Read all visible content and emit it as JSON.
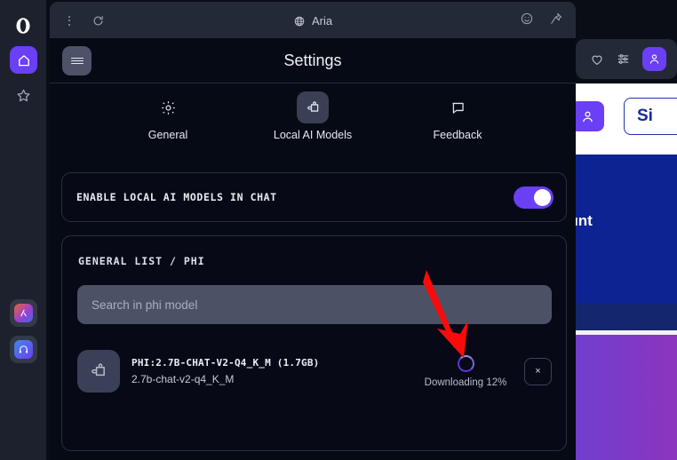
{
  "browser": {
    "sidebar": {
      "items": [
        {
          "name": "opera-logo",
          "icon": "opera-logo-icon",
          "label": "Opera"
        },
        {
          "name": "home",
          "icon": "home-icon",
          "label": "Home",
          "active": true
        },
        {
          "name": "bookmarks",
          "icon": "star-icon",
          "label": "Bookmarks",
          "active": false
        },
        {
          "name": "app-pinned-1",
          "icon": "app-icon",
          "label": "Pinned app",
          "active": false
        },
        {
          "name": "music-player",
          "icon": "headphones-icon",
          "label": "Player",
          "active": false
        }
      ]
    },
    "page_chrome": {
      "heart_icon": "heart-icon",
      "sliders_icon": "sliders-icon",
      "avatar_icon": "person-icon"
    },
    "background_page": {
      "sign_in_label": "Si",
      "account_text": "ount",
      "avatar_icon": "person-icon"
    }
  },
  "aria_window": {
    "titlebar": {
      "title": "Aria",
      "globe_icon": "globe-icon",
      "menu_icon": "more-vertical-icon",
      "reload_icon": "reload-icon",
      "smiley_icon": "smiley-icon",
      "pin_icon": "pin-icon"
    },
    "header": {
      "title": "Settings",
      "menu_icon": "hamburger-menu-icon"
    },
    "tabs": [
      {
        "label": "General",
        "icon": "gear-icon",
        "selected": false
      },
      {
        "label": "Local AI Models",
        "icon": "local-models-icon",
        "selected": true
      },
      {
        "label": "Feedback",
        "icon": "speech-bubble-icon",
        "selected": false
      }
    ],
    "toggle_row": {
      "label": "ENABLE LOCAL AI MODELS IN CHAT",
      "enabled": true,
      "accent_color": "#6a3ff5"
    },
    "model_list": {
      "heading": "GENERAL LIST / PHI",
      "search": {
        "placeholder": "Search in phi model",
        "value": ""
      },
      "items": [
        {
          "icon": "puzzle-piece-icon",
          "title": "PHI:2.7B-CHAT-V2-Q4_K_M (1.7GB)",
          "subtitle": "2.7b-chat-v2-q4_K_M",
          "status": "Downloading 12%",
          "progress_percent": 12,
          "cancel_label": "×",
          "spinner_color": "#5b35d8"
        }
      ]
    }
  },
  "annotation": {
    "arrow_color": "#fa0b0b",
    "points_at": "download-spinner"
  }
}
